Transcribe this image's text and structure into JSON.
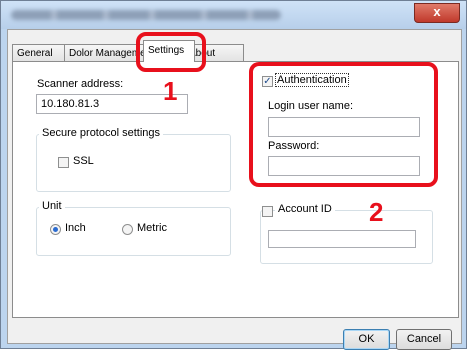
{
  "window": {
    "close_glyph": "x"
  },
  "tabs": [
    {
      "label": "General"
    },
    {
      "label": "Dolor Manageme"
    },
    {
      "label": "Settings"
    },
    {
      "label": "About"
    }
  ],
  "scanner": {
    "label": "Scanner address:",
    "value": "10.180.81.3"
  },
  "secure": {
    "title": "Secure protocol settings",
    "ssl_label": "SSL",
    "ssl_checked": false
  },
  "unit": {
    "title": "Unit",
    "inch_label": "Inch",
    "metric_label": "Metric",
    "selected": "Inch"
  },
  "auth": {
    "label": "Authentication",
    "checked": true,
    "login_label": "Login user name:",
    "login_value": "",
    "password_label": "Password:",
    "password_value": ""
  },
  "account": {
    "label": "Account ID",
    "checked": false,
    "value": ""
  },
  "buttons": {
    "ok": "OK",
    "cancel": "Cancel"
  },
  "callouts": {
    "one": "1",
    "two": "2"
  },
  "colors": {
    "highlight": "#e8101c",
    "selection": "#2a6bd0"
  }
}
